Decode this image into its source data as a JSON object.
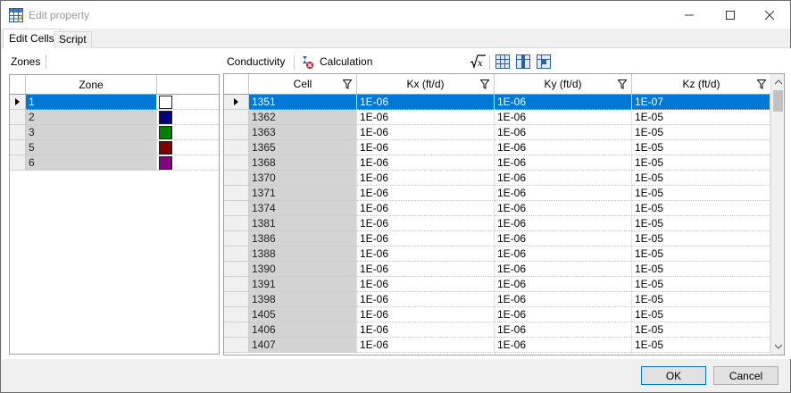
{
  "window": {
    "title": "Edit property"
  },
  "tabs": [
    {
      "label": "Edit Cells"
    },
    {
      "label": "Script"
    }
  ],
  "zones": {
    "title": "Zones",
    "column_header": "Zone",
    "rows": [
      {
        "zone": "1",
        "color": "#ffffff",
        "selected": true
      },
      {
        "zone": "2",
        "color": "#000080",
        "selected": false
      },
      {
        "zone": "3",
        "color": "#008000",
        "selected": false
      },
      {
        "zone": "5",
        "color": "#800000",
        "selected": false
      },
      {
        "zone": "6",
        "color": "#800080",
        "selected": false
      }
    ]
  },
  "toolbar": {
    "conductivity_label": "Conductivity",
    "calculation_label": "Calculation"
  },
  "grid": {
    "columns": [
      "Cell",
      "Kx (ft/d)",
      "Ky (ft/d)",
      "Kz (ft/d)"
    ],
    "rows": [
      [
        "1351",
        "1E-06",
        "1E-06",
        "1E-07"
      ],
      [
        "1362",
        "1E-06",
        "1E-06",
        "1E-05"
      ],
      [
        "1363",
        "1E-06",
        "1E-06",
        "1E-05"
      ],
      [
        "1365",
        "1E-06",
        "1E-06",
        "1E-05"
      ],
      [
        "1368",
        "1E-06",
        "1E-06",
        "1E-05"
      ],
      [
        "1370",
        "1E-06",
        "1E-06",
        "1E-05"
      ],
      [
        "1371",
        "1E-06",
        "1E-06",
        "1E-05"
      ],
      [
        "1374",
        "1E-06",
        "1E-06",
        "1E-05"
      ],
      [
        "1381",
        "1E-06",
        "1E-06",
        "1E-05"
      ],
      [
        "1386",
        "1E-06",
        "1E-06",
        "1E-05"
      ],
      [
        "1388",
        "1E-06",
        "1E-06",
        "1E-05"
      ],
      [
        "1390",
        "1E-06",
        "1E-06",
        "1E-05"
      ],
      [
        "1391",
        "1E-06",
        "1E-06",
        "1E-05"
      ],
      [
        "1398",
        "1E-06",
        "1E-06",
        "1E-05"
      ],
      [
        "1405",
        "1E-06",
        "1E-06",
        "1E-05"
      ],
      [
        "1406",
        "1E-06",
        "1E-06",
        "1E-05"
      ],
      [
        "1407",
        "1E-06",
        "1E-06",
        "1E-05"
      ]
    ],
    "selected_row": 0
  },
  "footer": {
    "ok_label": "OK",
    "cancel_label": "Cancel"
  },
  "colors": {
    "selection": "#0078d7",
    "readonly_cell": "#d3d3d3"
  }
}
